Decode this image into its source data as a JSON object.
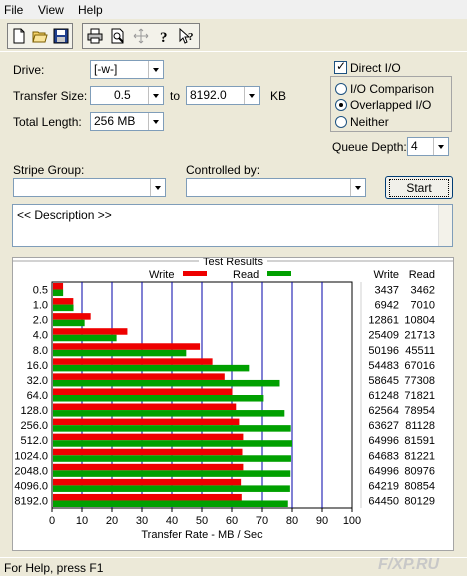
{
  "menu": [
    "File",
    "View",
    "Help"
  ],
  "form": {
    "drive_label": "Drive:",
    "drive_value": "[-w-]",
    "transfer_size_label": "Transfer Size:",
    "transfer_from": "0.5",
    "transfer_to_label": "to",
    "transfer_to": "8192.0",
    "transfer_unit": "KB",
    "total_length_label": "Total Length:",
    "total_length_value": "256 MB",
    "stripe_group_label": "Stripe Group:",
    "controlled_by_label": "Controlled by:",
    "start_label": "Start",
    "description": "<< Description >>"
  },
  "options": {
    "direct_io_label": "Direct I/O",
    "io_comparison_label": "I/O Comparison",
    "overlapped_io_label": "Overlapped I/O",
    "neither_label": "Neither",
    "queue_depth_label": "Queue Depth:",
    "queue_depth_value": "4"
  },
  "results": {
    "title": "Test Results",
    "write_label": "Write",
    "read_label": "Read",
    "write_color": "#ee0000",
    "read_color": "#00a000",
    "col_write": "Write",
    "col_read": "Read"
  },
  "status": "For Help, press F1",
  "watermark": "F/XP.RU",
  "chart_data": {
    "type": "bar",
    "orientation": "horizontal",
    "categories": [
      "0.5",
      "1.0",
      "2.0",
      "4.0",
      "8.0",
      "16.0",
      "32.0",
      "64.0",
      "128.0",
      "256.0",
      "512.0",
      "1024.0",
      "2048.0",
      "4096.0",
      "8192.0"
    ],
    "series": [
      {
        "name": "Write",
        "color": "#ee0000",
        "values": [
          3437,
          6942,
          12861,
          25409,
          50196,
          54483,
          58645,
          61248,
          62564,
          63627,
          64996,
          64683,
          64996,
          64219,
          64450
        ]
      },
      {
        "name": "Read",
        "color": "#00a000",
        "values": [
          3462,
          7010,
          10804,
          21713,
          45511,
          67016,
          77308,
          71821,
          78954,
          81128,
          81591,
          81221,
          80976,
          80854,
          80129
        ]
      }
    ],
    "xlabel": "Transfer Rate - MB / Sec",
    "ticks": [
      "0",
      "10",
      "20",
      "30",
      "40",
      "50",
      "60",
      "70",
      "80",
      "90",
      "100"
    ],
    "xlim": [
      0,
      100
    ],
    "grid": true
  }
}
